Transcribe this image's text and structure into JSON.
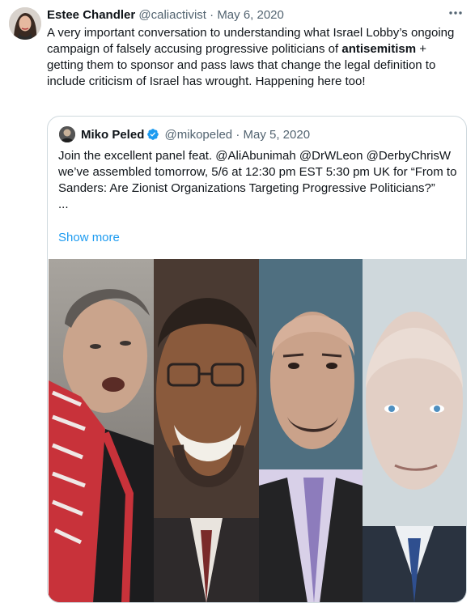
{
  "tweet": {
    "author_name": "Estee Chandler",
    "author_handle": "@caliactivist",
    "separator": "·",
    "date": "May 6, 2020",
    "more_icon": "more-horizontal-icon",
    "text_part1": "A very important conversation to understanding what Israel Lobby’s ongoing campaign of falsely accusing progressive politicians of ",
    "text_bold": "antisemitism",
    "text_part2": " + getting them to sponsor and pass laws that change the legal definition to include criticism of Israel has wrought. Happening here too!"
  },
  "quote": {
    "author_name": "Miko Peled",
    "author_handle": "@mikopeled",
    "separator": "·",
    "date": "May 5, 2020",
    "verified_icon": "verified-badge-icon",
    "verified_color": "#1d9bf0",
    "text_line": "Join the excellent panel feat. @AliAbunimah @DrWLeon @DerbyChrisW we’ve assembled tomorrow, 5/6 at 12:30 pm EST 5:30 pm UK for “From to Sanders: Are Zionist Organizations Targeting Progressive Politicians?”",
    "ellipsis": "...",
    "show_more": "Show more",
    "link_color": "#1d9bf0"
  }
}
